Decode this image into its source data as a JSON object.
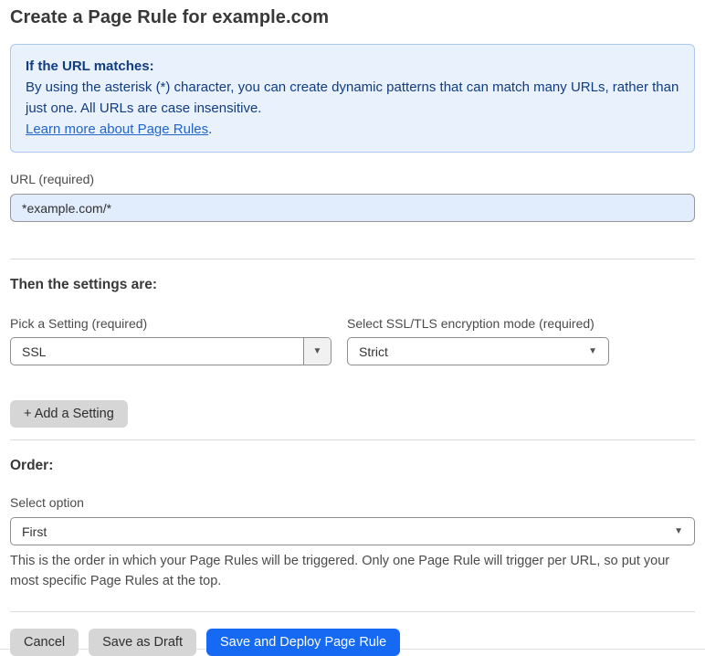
{
  "page": {
    "title": "Create a Page Rule for example.com"
  },
  "info_box": {
    "heading": "If the URL matches:",
    "body": "By using the asterisk (*) character, you can create dynamic patterns that can match many URLs, rather than just one. All URLs are case insensitive.",
    "link_label": "Learn more about Page Rules",
    "link_suffix": "."
  },
  "url_field": {
    "label": "URL (required)",
    "value": "*example.com/*"
  },
  "settings_section": {
    "heading": "Then the settings are:",
    "setting_select": {
      "label": "Pick a Setting (required)",
      "value": "SSL"
    },
    "mode_select": {
      "label": "Select SSL/TLS encryption mode (required)",
      "value": "Strict"
    },
    "add_setting_label": "+ Add a Setting"
  },
  "order_section": {
    "heading": "Order:",
    "select_label": "Select option",
    "select_value": "First",
    "help_text": "This is the order in which your Page Rules will be triggered. Only one Page Rule will trigger per URL, so put your most specific Page Rules at the top."
  },
  "footer": {
    "cancel_label": "Cancel",
    "save_draft_label": "Save as Draft",
    "save_deploy_label": "Save and Deploy Page Rule"
  },
  "icons": {
    "dropdown_arrow": "▼"
  },
  "colors": {
    "accent_blue": "#1569f3",
    "info_background": "#e9f2fc",
    "info_border": "#abc9ec",
    "info_text": "#113c80",
    "link_blue": "#2264cc",
    "url_input_background": "#e1ecfc",
    "button_gray": "#d6d6d6"
  }
}
